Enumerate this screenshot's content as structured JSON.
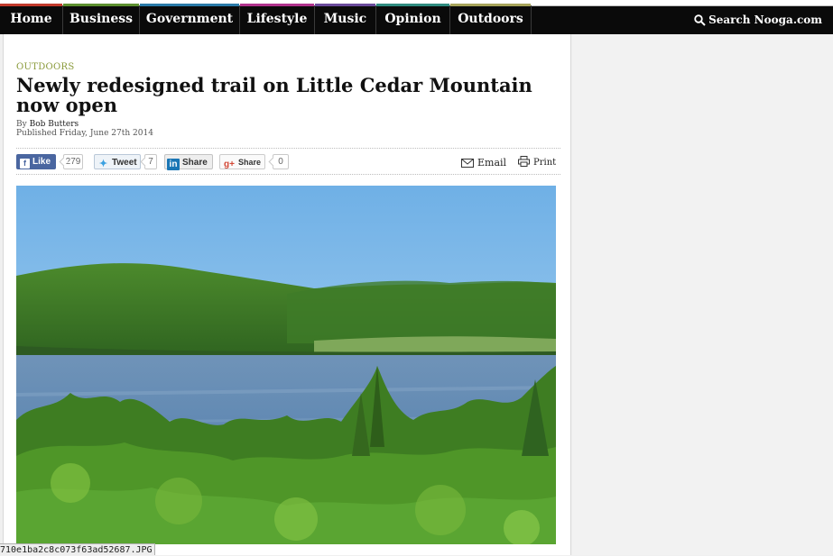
{
  "nav": {
    "items": [
      {
        "label": "Home",
        "stripe": "#c0392b"
      },
      {
        "label": "Business",
        "stripe": "#5c8f2f"
      },
      {
        "label": "Government",
        "stripe": "#2a7aa8"
      },
      {
        "label": "Lifestyle",
        "stripe": "#b0328c"
      },
      {
        "label": "Music",
        "stripe": "#6a4a9a"
      },
      {
        "label": "Opinion",
        "stripe": "#2f8b7f"
      },
      {
        "label": "Outdoors",
        "stripe": "#a6a35a"
      }
    ],
    "search_label": "Search Nooga.com"
  },
  "article": {
    "category": "OUTDOORS",
    "headline": "Newly redesigned trail on Little Cedar Mountain now open",
    "by_prefix": "By",
    "author": "Bob Butters",
    "published": "Published Friday, June 27th 2014"
  },
  "share": {
    "facebook_label": "Like",
    "facebook_count": "279",
    "twitter_label": "Tweet",
    "twitter_count": "7",
    "linkedin_label": "Share",
    "googleplus_label": "Share",
    "googleplus_count": "0",
    "email_label": "Email",
    "print_label": "Print"
  },
  "photo": {
    "subject": "Lake view from Little Cedar Mountain with forested ridge"
  },
  "status_bar": {
    "url_text": "710e1ba2c8c073f63ad52687.JPG"
  },
  "colors": {
    "nav_background": "#0a0a0a",
    "category_text": "#8a9a3a",
    "facebook_blue": "#4a66a0"
  }
}
